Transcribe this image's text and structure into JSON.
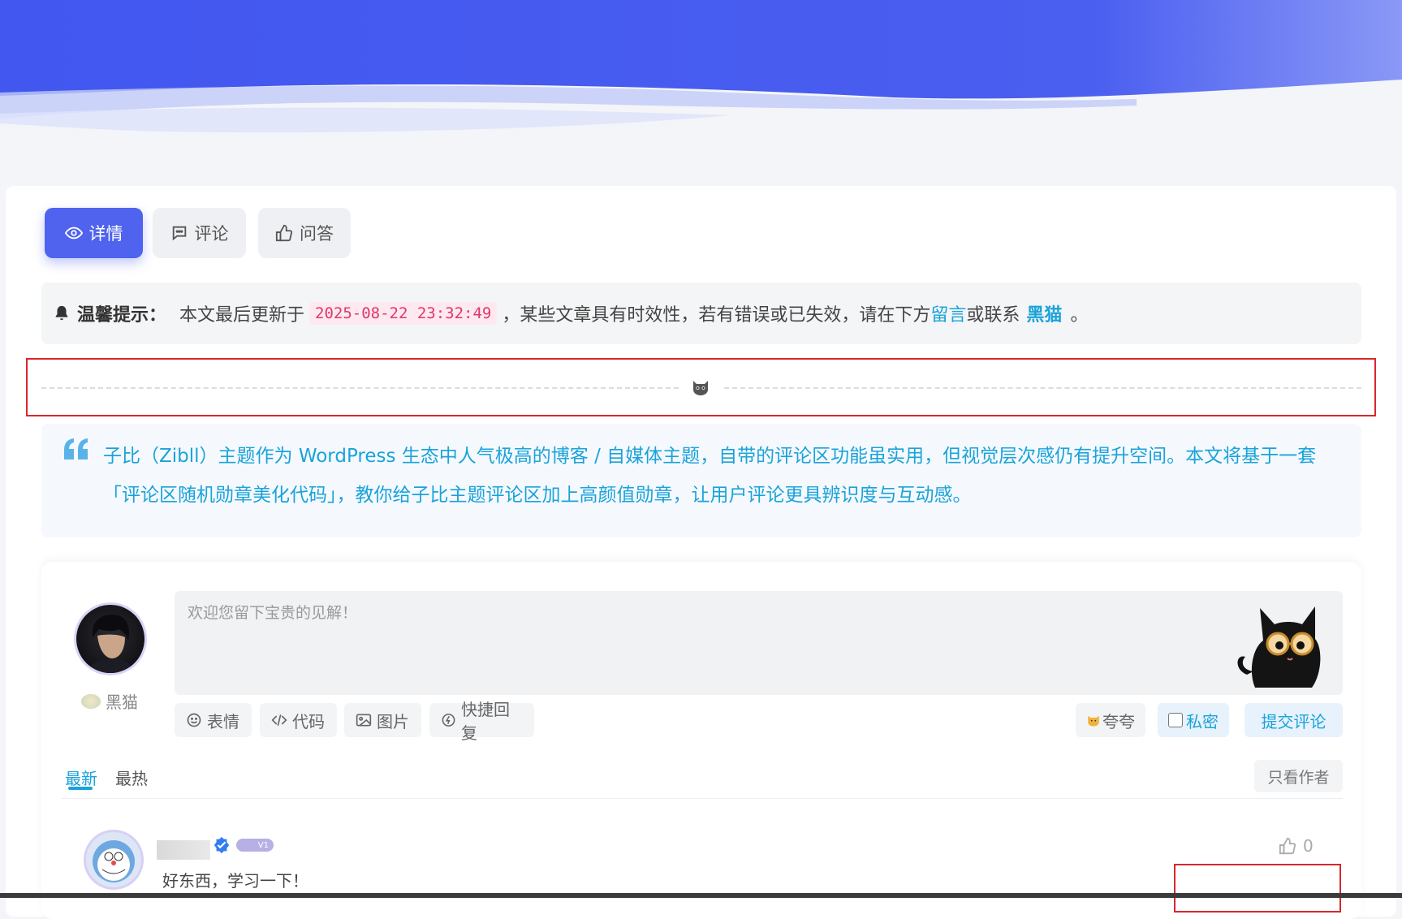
{
  "tabs": [
    {
      "label": "详情",
      "icon": "eye-icon",
      "active": true
    },
    {
      "label": "评论",
      "icon": "comment-icon",
      "active": false
    },
    {
      "label": "问答",
      "icon": "thumbs-up-icon",
      "active": false
    }
  ],
  "notice": {
    "icon": "bell-icon",
    "label": "温馨提示：",
    "text_before": "本文最后更新于",
    "date": "2025-08-22 23:32:49",
    "text_middle": "，某些文章具有时效性，若有错误或已失效，请在下方",
    "link_comment": "留言",
    "text_or": "或联系",
    "link_author": "黑猫",
    "text_end": "。"
  },
  "divider": {
    "icon": "cat-face-icon"
  },
  "quote": {
    "icon": "quote-icon",
    "text": "子比（Zibll）主题作为 WordPress 生态中人气极高的博客 / 自媒体主题，自带的评论区功能虽实用，但视觉层次感仍有提升空间。本文将基于一套「评论区随机勋章美化代码」，教你给子比主题评论区加上高颜值勋章，让用户评论更具辨识度与互动感。"
  },
  "comment_form": {
    "current_user": "黑猫",
    "placeholder": "欢迎您留下宝贵的见解！",
    "tools": [
      {
        "label": "表情",
        "icon": "smile-icon"
      },
      {
        "label": "代码",
        "icon": "code-icon"
      },
      {
        "label": "图片",
        "icon": "image-icon"
      },
      {
        "label": "快捷回复",
        "icon": "quick-reply-icon"
      }
    ],
    "kuakua_label": "夸夸",
    "private_label": "私密",
    "submit_label": "提交评论"
  },
  "sort": {
    "latest": "最新",
    "hot": "最热",
    "only_author": "只看作者"
  },
  "comments": [
    {
      "level_badge": "V1",
      "text": "好东西，学习一下！",
      "likes": "0"
    }
  ],
  "colors": {
    "accent": "#4f63ee",
    "link": "#1aa3d9",
    "date_pink": "#e0386b",
    "highlight_red": "#d9272e"
  }
}
